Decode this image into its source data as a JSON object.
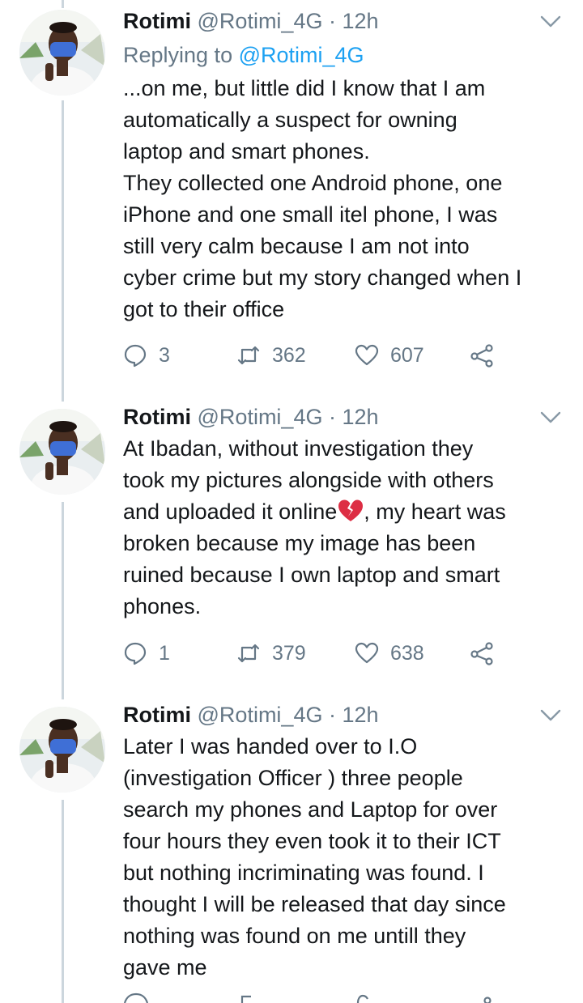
{
  "tweets": [
    {
      "name": "Rotimi",
      "handle": "@Rotimi_4G",
      "separator": "·",
      "time": "12h",
      "replying_prefix": "Replying to ",
      "replying_handle": "@Rotimi_4G",
      "text": "...on me, but little did I know that I am\nautomatically a suspect for owning\nlaptop and smart phones.\nThey collected one Android phone, one\niPhone and one small itel phone, I was\nstill very calm because I am not into\ncyber crime but my story changed when I\ngot to their office",
      "replies": "3",
      "retweets": "362",
      "likes": "607"
    },
    {
      "name": "Rotimi",
      "handle": "@Rotimi_4G",
      "separator": "·",
      "time": "12h",
      "text_before_emoji": "At Ibadan, without investigation they\ntook my pictures alongside with others\nand uploaded it online",
      "emoji": "broken-heart-icon",
      "text_after_emoji": ", my heart was\nbroken because my image has been\nruined because I own laptop and smart\nphones.",
      "replies": "1",
      "retweets": "379",
      "likes": "638"
    },
    {
      "name": "Rotimi",
      "handle": "@Rotimi_4G",
      "separator": "·",
      "time": "12h",
      "text": "Later I was handed over to I.O\n(investigation Officer ) three people\nsearch my phones and Laptop for over\nfour hours they even took it to their ICT\nbut nothing incriminating was found. I\nthought I will be released that day since\nnothing was found on me untill they\ngave me"
    }
  ],
  "icons": {
    "reply": "reply-icon",
    "retweet": "retweet-icon",
    "like": "heart-icon",
    "share": "share-icon",
    "menu": "chevron-down-icon"
  },
  "colors": {
    "text": "#14171a",
    "secondary": "#657786",
    "link": "#1da1f2",
    "thread_line": "#ccd6dd"
  }
}
